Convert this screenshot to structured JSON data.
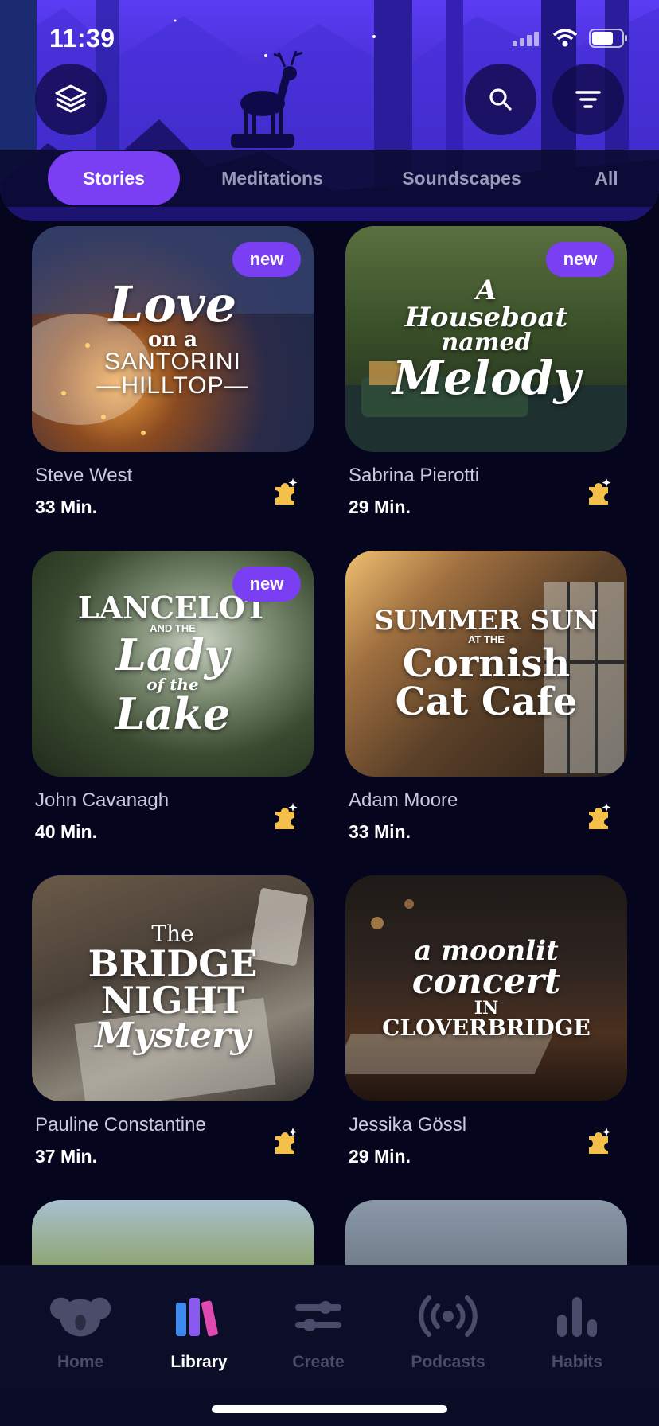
{
  "status_bar": {
    "time": "11:39"
  },
  "header": {
    "tabs": [
      {
        "label": "Stories",
        "active": true
      },
      {
        "label": "Meditations",
        "active": false
      },
      {
        "label": "Soundscapes",
        "active": false
      },
      {
        "label": "All",
        "active": false
      }
    ]
  },
  "cards": [
    {
      "cover_title": [
        "Love",
        "on a",
        "SANTORINI",
        "—HILLTOP—"
      ],
      "badge": "new",
      "author": "Steve West",
      "duration": "33 Min."
    },
    {
      "cover_title": [
        "A",
        "Houseboat",
        "named",
        "Melody"
      ],
      "badge": "new",
      "author": "Sabrina Pierotti",
      "duration": "29 Min."
    },
    {
      "cover_title": [
        "LANCELOT",
        "AND THE",
        "Lady",
        "of the",
        "Lake"
      ],
      "badge": "new",
      "author": "John Cavanagh",
      "duration": "40 Min."
    },
    {
      "cover_title": [
        "SUMMER SUN",
        "AT THE",
        "Cornish",
        "Cat Cafe"
      ],
      "badge": "",
      "author": "Adam Moore",
      "duration": "33 Min."
    },
    {
      "cover_title": [
        "The",
        "BRIDGE",
        "NIGHT",
        "Mystery"
      ],
      "badge": "",
      "author": "Pauline Constantine",
      "duration": "37 Min."
    },
    {
      "cover_title": [
        "a moonlit",
        "concert",
        "IN",
        "CLOVERBRIDGE"
      ],
      "badge": "",
      "author": "Jessika Gössl",
      "duration": "29 Min."
    }
  ],
  "bottom_nav": [
    {
      "label": "Home",
      "icon": "koala-icon",
      "active": false
    },
    {
      "label": "Library",
      "icon": "books-icon",
      "active": true
    },
    {
      "label": "Create",
      "icon": "sliders-icon",
      "active": false
    },
    {
      "label": "Podcasts",
      "icon": "broadcast-icon",
      "active": false
    },
    {
      "label": "Habits",
      "icon": "bar-chart-icon",
      "active": false
    }
  ],
  "colors": {
    "accent": "#7a3ff2",
    "background": "#05061e",
    "puzzle": "#f5c04a"
  }
}
